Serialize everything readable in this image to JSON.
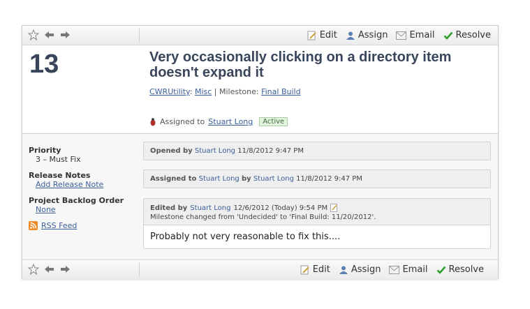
{
  "toolbar": {
    "edit_label": "Edit",
    "assign_label": "Assign",
    "email_label": "Email",
    "resolve_label": "Resolve"
  },
  "case": {
    "number": "13",
    "title": "Very occasionally clicking on a directory item doesn't expand it",
    "project": "CWRUtility",
    "area": "Misc",
    "milestone_label": "Milestone:",
    "milestone": "Final Build",
    "assigned_prefix": "Assigned to",
    "assigned_to": "Stuart Long",
    "status": "Active"
  },
  "sidebar": {
    "priority_label": "Priority",
    "priority_value": "3 – Must Fix",
    "release_notes_label": "Release Notes",
    "release_notes_link": "Add Release Note",
    "backlog_label": "Project Backlog Order",
    "backlog_value": "None",
    "rss_label": "RSS Feed"
  },
  "events": [
    {
      "action": "Opened by",
      "user": "Stuart Long",
      "date": "11/8/2012 9:47 PM"
    },
    {
      "action": "Assigned to",
      "user": "Stuart Long",
      "by": "by",
      "by_user": "Stuart Long",
      "date": "11/8/2012 9:47 PM"
    },
    {
      "action": "Edited by",
      "user": "Stuart Long",
      "date": "12/6/2012 (Today) 9:54 PM",
      "change": "Milestone changed from 'Undecided' to 'Final Build: 11/20/2012'.",
      "comment": "Probably not very reasonable to fix this...."
    }
  ],
  "colors": {
    "title": "#39455a",
    "link": "#3a5f99",
    "status_bg": "#e3f3e0",
    "resolve_check": "#2e9e2e"
  }
}
